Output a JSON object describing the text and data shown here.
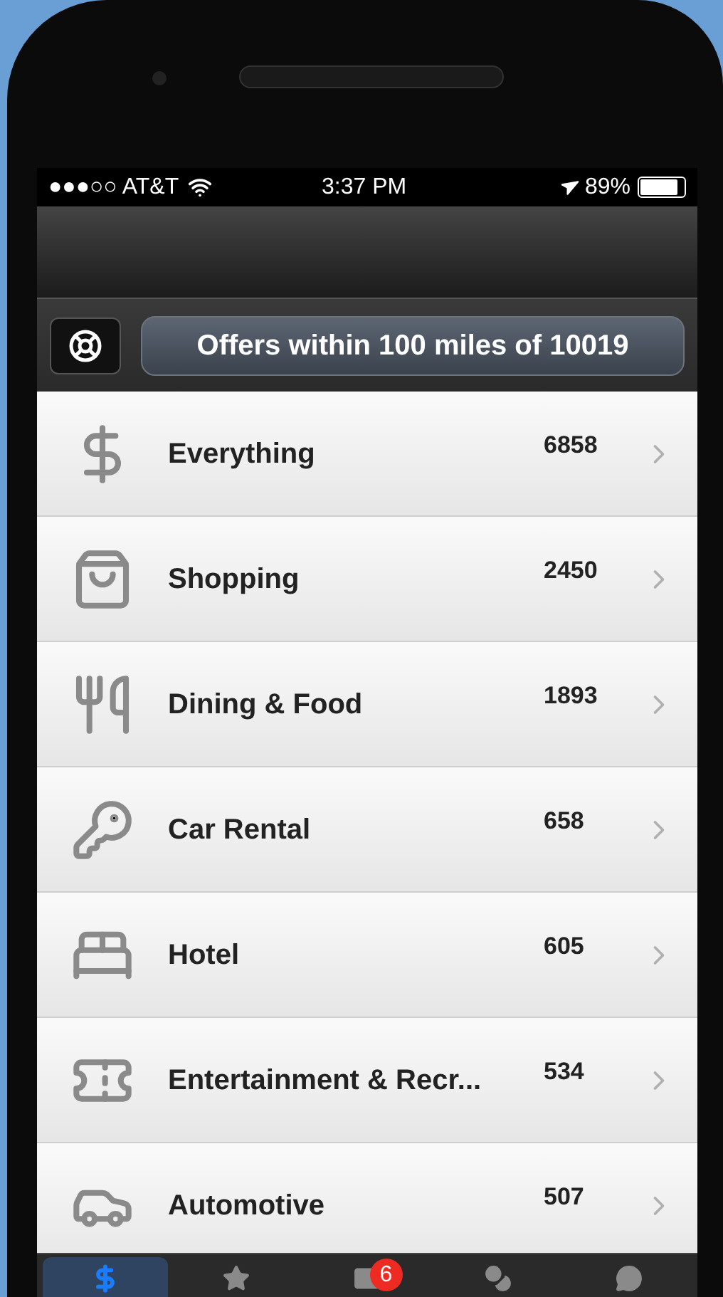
{
  "status_bar": {
    "carrier": "●●●○○ AT&T",
    "time": "3:37 PM",
    "battery": "89%"
  },
  "header": {
    "title": "Offers within 100 miles of 10019"
  },
  "categories": [
    {
      "kind": "dollar",
      "label": "Everything",
      "count": "6858"
    },
    {
      "kind": "shopping",
      "label": "Shopping",
      "count": "2450"
    },
    {
      "kind": "dining",
      "label": "Dining & Food",
      "count": "1893"
    },
    {
      "kind": "car-rental",
      "label": "Car Rental",
      "count": "658"
    },
    {
      "kind": "hotel",
      "label": "Hotel",
      "count": "605"
    },
    {
      "kind": "entertainment",
      "label": "Entertainment & Recr...",
      "count": "534"
    },
    {
      "kind": "automotive",
      "label": "Automotive",
      "count": "507"
    }
  ],
  "tab_bar": [
    {
      "kind": "dollar",
      "selected": true
    },
    {
      "kind": "star",
      "selected": false
    },
    {
      "kind": "mail",
      "selected": false,
      "badge": "6"
    },
    {
      "kind": "coins",
      "selected": false
    },
    {
      "kind": "chat",
      "selected": false
    }
  ]
}
